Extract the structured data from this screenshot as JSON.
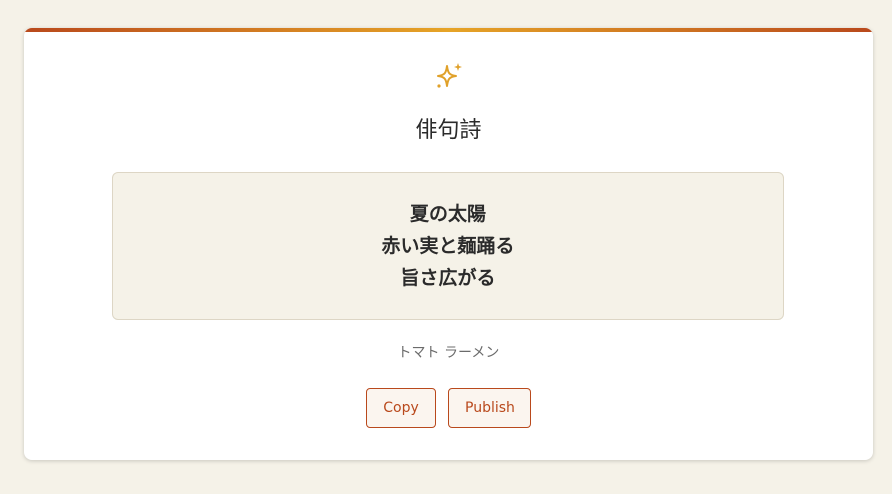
{
  "card": {
    "icon": "sparkle-icon",
    "title": "俳句詩",
    "poem_lines": [
      "夏の太陽",
      "赤い実と麺踊る",
      "旨さ広がる"
    ],
    "subtitle": "トマト ラーメン"
  },
  "buttons": {
    "copy_label": "Copy",
    "publish_label": "Publish"
  },
  "colors": {
    "accent": "#b9491c",
    "accent_gold": "#e6a427",
    "page_background": "#f5f2e8"
  }
}
